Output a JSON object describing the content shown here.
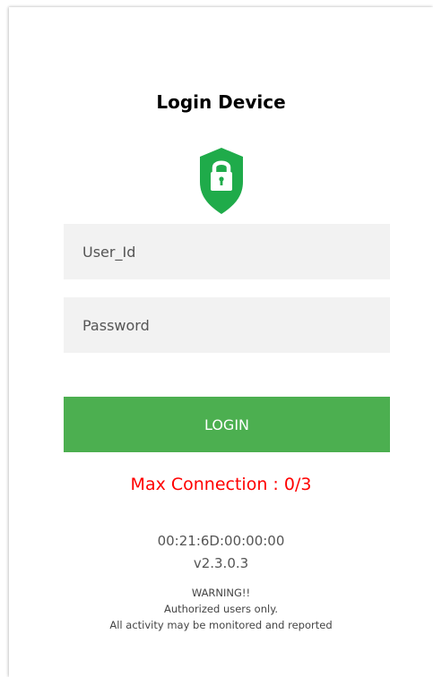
{
  "login": {
    "title": "Login Device",
    "user_id_placeholder": "User_Id",
    "password_placeholder": "Password",
    "login_label": "LOGIN"
  },
  "status": {
    "max_connection": "Max Connection : 0/3",
    "mac_address": "00:21:6D:00:00:00",
    "version": "v2.3.0.3"
  },
  "warning": {
    "line1": "WARNING!!",
    "line2": "Authorized users only.",
    "line3": "All activity may be monitored and reported"
  },
  "icons": {
    "shield": "shield-lock-icon"
  },
  "colors": {
    "accent": "#4caf50",
    "shield": "#1fab4a",
    "error": "#ff0000",
    "field_bg": "#f2f2f2"
  }
}
